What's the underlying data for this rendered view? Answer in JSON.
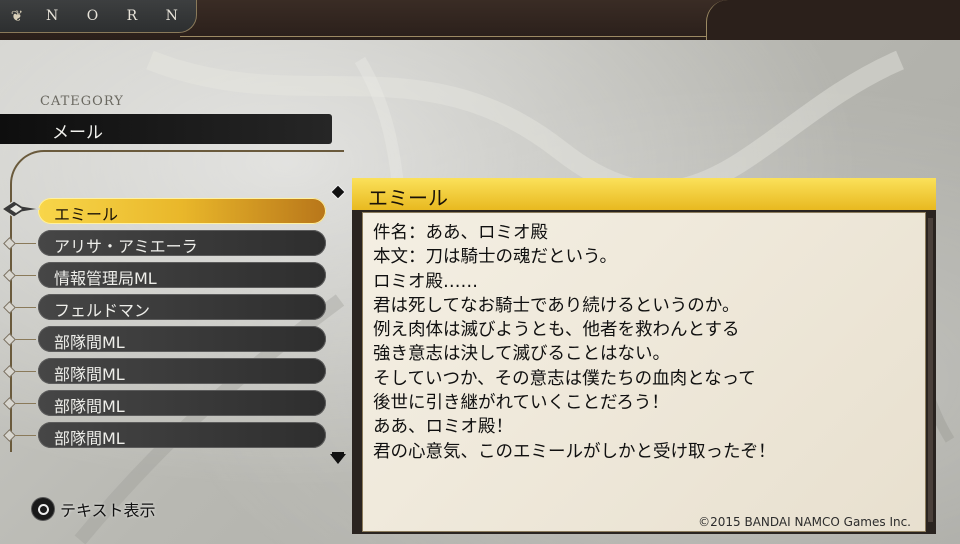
{
  "header": {
    "brand": "N O R N",
    "brand_icon": "leaf-icon"
  },
  "category": {
    "heading": "CATEGORY",
    "value": "メール"
  },
  "list": {
    "items": [
      {
        "label": "エミール",
        "selected": true
      },
      {
        "label": "アリサ・アミエーラ"
      },
      {
        "label": "情報管理局ML"
      },
      {
        "label": "フェルドマン"
      },
      {
        "label": "部隊間ML"
      },
      {
        "label": "部隊間ML"
      },
      {
        "label": "部隊間ML"
      },
      {
        "label": "部隊間ML"
      }
    ]
  },
  "mail": {
    "title": "エミール",
    "lines": [
      "件名：ああ、ロミオ殿",
      "本文：刀は騎士の魂だという。",
      "ロミオ殿……",
      "君は死してなお騎士であり続けるというのか。",
      "例え肉体は滅びようとも、他者を救わんとする",
      "強き意志は決して滅びることはない。",
      "そしていつか、その意志は僕たちの血肉となって",
      "後世に引き継がれていくことだろう！",
      "ああ、ロミオ殿！",
      "君の心意気、このエミールがしかと受け取ったぞ！"
    ],
    "copyright": "©2015 BANDAI NAMCO Games Inc."
  },
  "hint": {
    "button_icon": "circle-button-icon",
    "label": "テキスト表示"
  },
  "colors": {
    "accent_yellow": "#f3c632",
    "panel_dark": "#2a2420",
    "paper": "#f0eadc"
  }
}
